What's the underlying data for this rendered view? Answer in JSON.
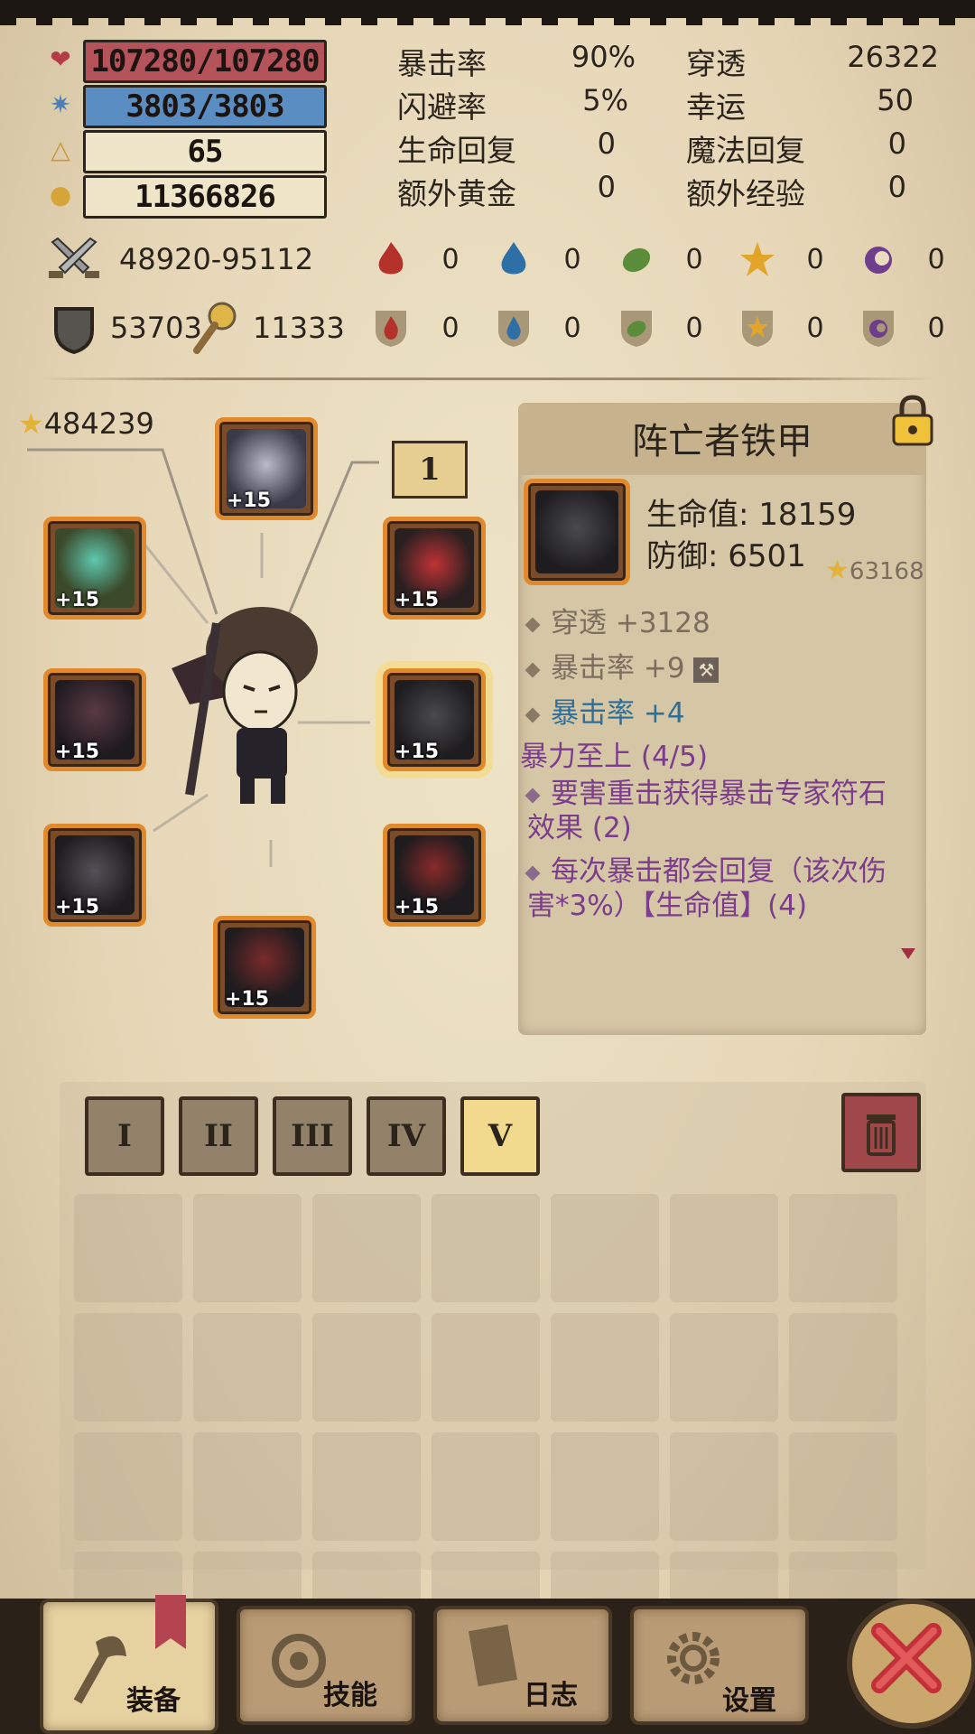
{
  "stats": {
    "hp": "107280/107280",
    "mp": "3803/3803",
    "level": "65",
    "gold": "11366826",
    "attack": "48920-95112",
    "defense": "53703",
    "magic_defense": "11333"
  },
  "attributes": [
    {
      "label": "暴击率",
      "value": "90%"
    },
    {
      "label": "闪避率",
      "value": "5%"
    },
    {
      "label": "生命回复",
      "value": "0"
    },
    {
      "label": "额外黄金",
      "value": "0"
    }
  ],
  "attributes_right": [
    {
      "label": "穿透",
      "value": "26322"
    },
    {
      "label": "幸运",
      "value": "50"
    },
    {
      "label": "魔法回复",
      "value": "0"
    },
    {
      "label": "额外经验",
      "value": "0"
    }
  ],
  "elements_attack": [
    "0",
    "0",
    "0",
    "0",
    "0"
  ],
  "elements_defense": [
    "0",
    "0",
    "0",
    "0",
    "0"
  ],
  "element_colors": {
    "fire": "#b4322a",
    "water": "#2e6fa6",
    "nature": "#5b8c3a",
    "light": "#e2a52a",
    "shadow": "#6e3d8c"
  },
  "equipment": {
    "score": "484239",
    "page_marker": "1",
    "plus_label": "+15"
  },
  "item": {
    "name": "阵亡者铁甲",
    "hp_line": "生命值: 18159",
    "def_line": "防御: 6501",
    "score": "63168",
    "attr1": "穿透 +3128",
    "attr2": "暴击率 +9",
    "attr3": "暴击率 +4",
    "set_name": "暴力至上 (4/5)",
    "set_bonus1": "要害重击获得暴击专家符石效果 (2)",
    "set_bonus2": "每次暴击都会回复（该次伤害*3%）【生命值】(4)"
  },
  "tabs": [
    "I",
    "II",
    "III",
    "IV",
    "V"
  ],
  "nav": {
    "equip": "装备",
    "skills": "技能",
    "log": "日志",
    "settings": "设置"
  },
  "icons": [
    "heart-icon",
    "mana-icon",
    "level-icon",
    "gold-icon",
    "sword-icon",
    "shield-icon",
    "magic-shield-icon",
    "star-icon",
    "lock-icon",
    "trash-icon",
    "close-icon"
  ]
}
